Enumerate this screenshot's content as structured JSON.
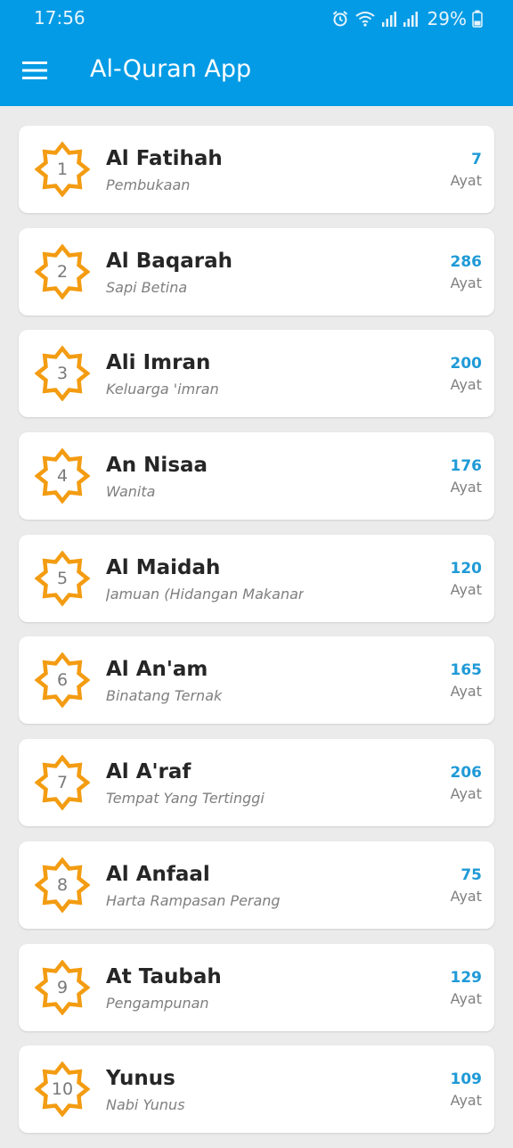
{
  "status_bar": {
    "time": "17:56",
    "battery": "29%",
    "icons": [
      "alarm-icon",
      "wifi-icon",
      "signal-icon",
      "signal-icon",
      "battery-icon"
    ]
  },
  "toolbar": {
    "menu_icon": "hamburger-menu-icon",
    "title": "Al-Quran App"
  },
  "colors": {
    "appbar": "#039be5",
    "badge": "#f39c12",
    "ayat_count": "#1f9ad6",
    "background": "#ebebeb"
  },
  "surahs": [
    {
      "number": "1",
      "name": "Al Fatihah",
      "meaning": "Pembukaan",
      "ayat": "7",
      "ayat_label": "Ayat"
    },
    {
      "number": "2",
      "name": "Al Baqarah",
      "meaning": "Sapi Betina",
      "ayat": "286",
      "ayat_label": "Ayat"
    },
    {
      "number": "3",
      "name": "Ali Imran",
      "meaning": "Keluarga 'imran",
      "ayat": "200",
      "ayat_label": "Ayat"
    },
    {
      "number": "4",
      "name": "An Nisaa",
      "meaning": "Wanita",
      "ayat": "176",
      "ayat_label": "Ayat"
    },
    {
      "number": "5",
      "name": "Al Maidah",
      "meaning": "Jamuan (Hidangan Makanan)",
      "ayat": "120",
      "ayat_label": "Ayat"
    },
    {
      "number": "6",
      "name": "Al An'am",
      "meaning": "Binatang Ternak",
      "ayat": "165",
      "ayat_label": "Ayat"
    },
    {
      "number": "7",
      "name": "Al A'raf",
      "meaning": "Tempat Yang Tertinggi",
      "ayat": "206",
      "ayat_label": "Ayat"
    },
    {
      "number": "8",
      "name": "Al Anfaal",
      "meaning": "Harta Rampasan Perang",
      "ayat": "75",
      "ayat_label": "Ayat"
    },
    {
      "number": "9",
      "name": "At Taubah",
      "meaning": "Pengampunan",
      "ayat": "129",
      "ayat_label": "Ayat"
    },
    {
      "number": "10",
      "name": "Yunus",
      "meaning": "Nabi Yunus",
      "ayat": "109",
      "ayat_label": "Ayat"
    }
  ]
}
